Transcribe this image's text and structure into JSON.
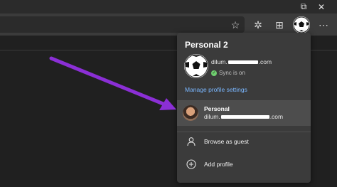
{
  "window": {
    "restore_glyph": "⧉",
    "close_glyph": "✕"
  },
  "toolbar": {
    "favorite_icon": "☆",
    "favorites_icon": "✲",
    "collections_icon": "⊞",
    "more_icon": "⋯"
  },
  "profile_menu": {
    "title": "Personal 2",
    "current_email_start": "dilum.",
    "current_email_end": ".com",
    "sync_status": "Sync is on",
    "manage_link": "Manage profile settings",
    "other_profile": {
      "name": "Personal",
      "email_start": "dilum.",
      "email_end": ".com"
    },
    "actions": [
      {
        "label": "Browse as guest",
        "icon": "guest-icon"
      },
      {
        "label": "Add profile",
        "icon": "add-icon"
      }
    ]
  },
  "colors": {
    "menu_bg": "#3b3b3b",
    "link": "#7ab7ff",
    "arrow": "#8b2fd6"
  }
}
